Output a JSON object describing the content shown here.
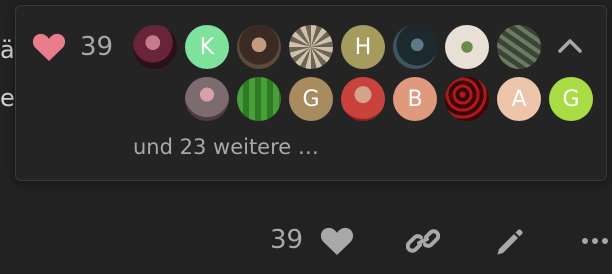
{
  "post": {
    "fragment_line1": "äi",
    "fragment_line2": "e"
  },
  "likes_popup": {
    "count": "39",
    "more_text": "und 23 weitere …",
    "heart_color": "#ea7c8c",
    "avatars_row1": [
      {
        "label": "",
        "kind": "photo",
        "bg": "#5a2a3a"
      },
      {
        "label": "K",
        "kind": "letter",
        "bg": "#7ee29c"
      },
      {
        "label": "",
        "kind": "photo",
        "bg": "#3a2a22"
      },
      {
        "label": "",
        "kind": "photo",
        "bg": "#8a7f74"
      },
      {
        "label": "H",
        "kind": "letter",
        "bg": "#a59b5d"
      },
      {
        "label": "",
        "kind": "photo",
        "bg": "#24323a"
      },
      {
        "label": "",
        "kind": "photo",
        "bg": "#d9d2c8"
      },
      {
        "label": "",
        "kind": "photo",
        "bg": "#4d5a4a"
      }
    ],
    "avatars_row2": [
      {
        "label": "",
        "kind": "photo",
        "bg": "#7c6c70"
      },
      {
        "label": "",
        "kind": "photo",
        "bg": "#3e8a2e"
      },
      {
        "label": "G",
        "kind": "letter",
        "bg": "#a88b5f"
      },
      {
        "label": "",
        "kind": "photo",
        "bg": "#c9433c"
      },
      {
        "label": "B",
        "kind": "letter",
        "bg": "#df9a7d"
      },
      {
        "label": "",
        "kind": "photo",
        "bg": "#6a1012"
      },
      {
        "label": "A",
        "kind": "letter",
        "bg": "#ecc5aa"
      },
      {
        "label": "G",
        "kind": "letter",
        "bg": "#aadd45"
      }
    ]
  },
  "actions": {
    "like_count": "39",
    "icons": [
      "heart-icon",
      "link-icon",
      "pencil-icon",
      "ellipsis-icon"
    ]
  },
  "colors": {
    "background": "#222222",
    "popup_border": "#3a3a3a",
    "muted_text": "#a8a8a8",
    "icon_gray": "#a8a8a8"
  }
}
